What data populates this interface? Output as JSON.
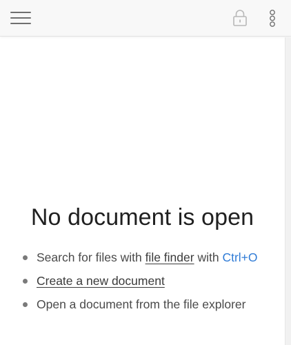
{
  "toolbar": {
    "menu_icon": "hamburger-icon",
    "lock_icon": "lock-icon",
    "more_icon": "vertical-dots-icon"
  },
  "main": {
    "title": "No document is open",
    "actions": [
      {
        "prefix": "Search for files with ",
        "link_label": "file finder",
        "middle": " with ",
        "hotkey": "Ctrl+O"
      },
      {
        "link_label": "Create a new document"
      },
      {
        "text": "Open a document from the file explorer"
      }
    ]
  },
  "colors": {
    "accent": "#2f7bd6",
    "toolbar_bg": "#f8f8f8",
    "text": "#4a4a4a",
    "icon": "#6f6f6f"
  }
}
